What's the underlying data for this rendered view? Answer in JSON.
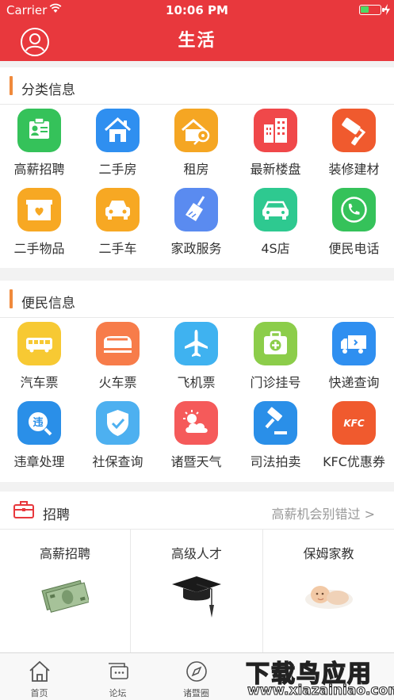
{
  "status": {
    "carrier": "Carrier",
    "time": "10:06 PM"
  },
  "header": {
    "title": "生活"
  },
  "sections": {
    "category": {
      "title": "分类信息",
      "items": [
        {
          "label": "高薪招聘",
          "icon": "job-card-icon",
          "color": "#35c25a"
        },
        {
          "label": "二手房",
          "icon": "house-icon",
          "color": "#2f8ff0"
        },
        {
          "label": "租房",
          "icon": "house-key-icon",
          "color": "#f5a623"
        },
        {
          "label": "最新楼盘",
          "icon": "building-icon",
          "color": "#f0484a"
        },
        {
          "label": "装修建材",
          "icon": "paint-roller-icon",
          "color": "#f05a2e"
        },
        {
          "label": "二手物品",
          "icon": "gift-box-icon",
          "color": "#f7a823"
        },
        {
          "label": "二手车",
          "icon": "car-icon",
          "color": "#f7a823"
        },
        {
          "label": "家政服务",
          "icon": "broom-icon",
          "color": "#5a8bf0"
        },
        {
          "label": "4S店",
          "icon": "sedan-icon",
          "color": "#2ec990"
        },
        {
          "label": "便民电话",
          "icon": "phone-icon",
          "color": "#35c25a"
        }
      ]
    },
    "convenience": {
      "title": "便民信息",
      "items": [
        {
          "label": "汽车票",
          "icon": "bus-icon",
          "color": "#f7c933"
        },
        {
          "label": "火车票",
          "icon": "train-icon",
          "color": "#f77c4a"
        },
        {
          "label": "飞机票",
          "icon": "plane-icon",
          "color": "#3fb2f0"
        },
        {
          "label": "门诊挂号",
          "icon": "medical-kit-icon",
          "color": "#8ccd4a"
        },
        {
          "label": "快递查询",
          "icon": "truck-icon",
          "color": "#2f8ff0"
        },
        {
          "label": "违章处理",
          "icon": "violation-search-icon",
          "color": "#2a8fe8"
        },
        {
          "label": "社保查询",
          "icon": "shield-check-icon",
          "color": "#4db0f0"
        },
        {
          "label": "诸暨天气",
          "icon": "weather-icon",
          "color": "#f55a5a"
        },
        {
          "label": "司法拍卖",
          "icon": "gavel-icon",
          "color": "#2a8fe8"
        },
        {
          "label": "KFC优惠券",
          "icon": "kfc-logo-icon",
          "color": "#f05a2e",
          "logo_text": "KFC"
        }
      ]
    }
  },
  "jobs": {
    "title": "招聘",
    "more": "高薪机会别错过 >",
    "cards": [
      {
        "label": "高薪招聘",
        "image": "money-image"
      },
      {
        "label": "高级人才",
        "image": "graduation-cap-image"
      },
      {
        "label": "保姆家教",
        "image": "baby-image"
      }
    ]
  },
  "tabbar": {
    "tabs": [
      {
        "label": "首页",
        "icon": "home-icon"
      },
      {
        "label": "论坛",
        "icon": "forum-icon"
      },
      {
        "label": "诸暨圈",
        "icon": "compass-icon"
      }
    ]
  },
  "watermark": {
    "top": "下载鸟应用",
    "bottom": "www.xiazainiao.com"
  }
}
